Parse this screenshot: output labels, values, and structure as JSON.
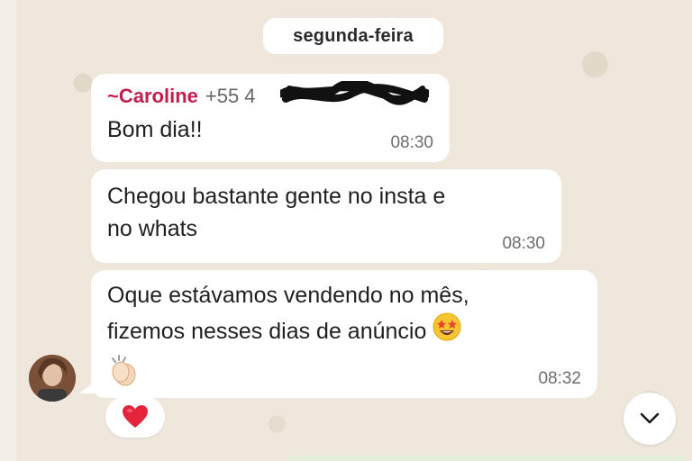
{
  "date_separator": "segunda-feira",
  "messages": [
    {
      "sender_name": "~Caroline",
      "sender_phone": "+55 4",
      "text": "Bom dia!!",
      "time": "08:30"
    },
    {
      "text": "Chegou bastante gente no insta e\nno whats",
      "time": "08:30"
    },
    {
      "text": "Oque estávamos  vendendo no mês,\nfizemos nesses dias de anúncio",
      "time": "08:32",
      "emojis": [
        "star-struck-emoji",
        "clapping-hands-emoji"
      ]
    }
  ],
  "reaction": "heart-reaction",
  "scroll_button_icon": "chevron-down-icon",
  "colors": {
    "sender_name": "#c21e4b",
    "bubble": "#ffffff",
    "background": "#efe7dc",
    "timestamp": "#6d6d6d"
  }
}
